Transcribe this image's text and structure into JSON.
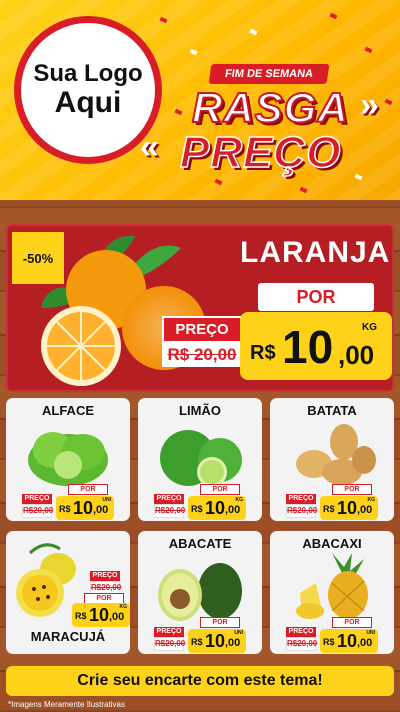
{
  "logo": {
    "line1": "Sua Logo",
    "line2": "Aqui"
  },
  "header": {
    "ribbon": "FIM DE SEMANA",
    "title_top": "RASGA",
    "title_bottom": "PREÇO"
  },
  "hero": {
    "discount": "-50%",
    "name": "LARANJA",
    "por_label": "POR",
    "old_label": "PREÇO",
    "old_price": "R$ 20,00",
    "currency": "R$",
    "price_int": "10",
    "price_cents": ",00",
    "unit": "KG"
  },
  "products": [
    {
      "name": "ALFACE",
      "old_label": "PREÇO",
      "old_price": "R$20,00",
      "por": "POR",
      "currency": "R$",
      "price_int": "10",
      "price_cents": ",00",
      "unit": "UNI"
    },
    {
      "name": "LIMÃO",
      "old_label": "PREÇO",
      "old_price": "R$20,00",
      "por": "POR",
      "currency": "R$",
      "price_int": "10",
      "price_cents": ",00",
      "unit": "KG"
    },
    {
      "name": "BATATA",
      "old_label": "PREÇO",
      "old_price": "R$20,00",
      "por": "POR",
      "currency": "R$",
      "price_int": "10",
      "price_cents": ",00",
      "unit": "KG"
    },
    {
      "name": "MARACUJÁ",
      "old_label": "PREÇO",
      "old_price": "R$20,00",
      "por": "POR",
      "currency": "R$",
      "price_int": "10",
      "price_cents": ",00",
      "unit": "KG"
    },
    {
      "name": "ABACATE",
      "old_label": "PREÇO",
      "old_price": "R$20,00",
      "por": "POR",
      "currency": "R$",
      "price_int": "10",
      "price_cents": ",00",
      "unit": "UNI"
    },
    {
      "name": "ABACAXI",
      "old_label": "PREÇO",
      "old_price": "R$20,00",
      "por": "POR",
      "currency": "R$",
      "price_int": "10",
      "price_cents": ",00",
      "unit": "UNI"
    }
  ],
  "footer": {
    "cta": "Crie seu encarte com este tema!",
    "disclaimer": "*Imagens Meramente Ilustrativas"
  },
  "colors": {
    "yellow": "#ffd21a",
    "red": "#d91d26",
    "wood": "#9c4e26"
  }
}
